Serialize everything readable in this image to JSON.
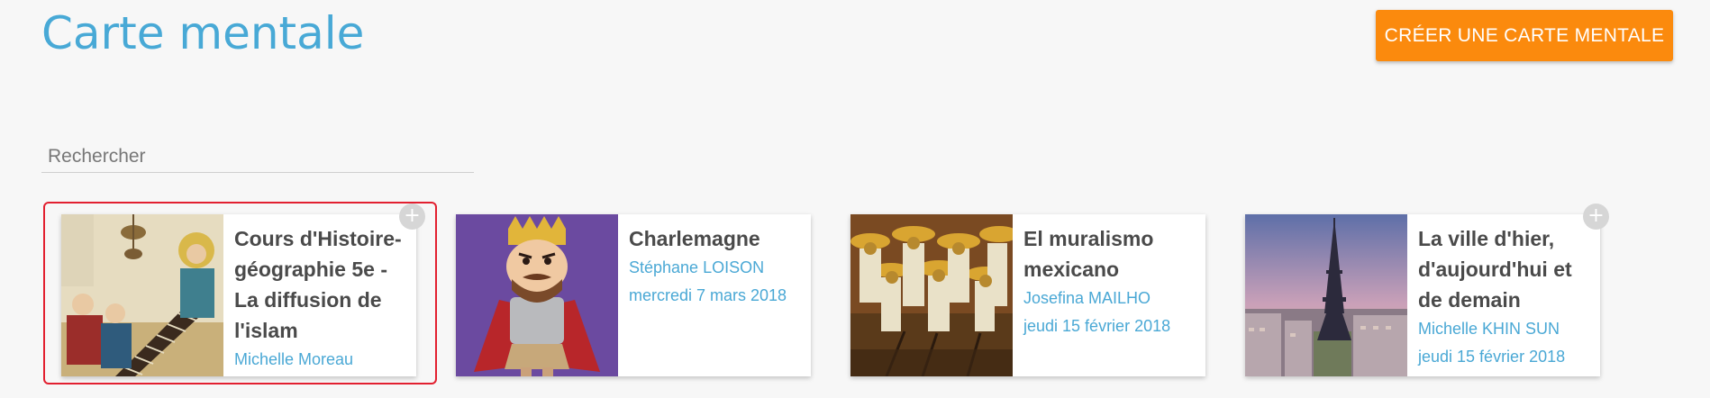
{
  "page": {
    "title": "Carte mentale"
  },
  "toolbar": {
    "create_label": "CRÉER UNE CARTE MENTALE"
  },
  "search": {
    "placeholder": "Rechercher",
    "value": ""
  },
  "cards": [
    {
      "title": "Cours d'Histoire-géographie 5e - La diffusion de l'islam",
      "author": "Michelle Moreau",
      "date": "",
      "selected": true,
      "image": "islam-manuscript-painting"
    },
    {
      "title": "Charlemagne",
      "author": "Stéphane LOISON",
      "date": "mercredi 7 mars 2018",
      "selected": false,
      "image": "charlemagne-cartoon"
    },
    {
      "title": "El muralismo mexicano",
      "author": "Josefina MAILHO",
      "date": "jeudi 15 février 2018",
      "selected": false,
      "image": "mexican-mural"
    },
    {
      "title": "La ville d'hier, d'aujourd'hui et de demain",
      "author": "Michelle KHIN SUN",
      "date": "jeudi 15 février 2018",
      "selected": false,
      "image": "paris-eiffel-tower"
    }
  ],
  "icons": {
    "add": "plus-icon"
  },
  "colors": {
    "accent": "#48a9d6",
    "button": "#fb8a0d",
    "selection": "#e22030",
    "meta": "#4aa8d5"
  }
}
